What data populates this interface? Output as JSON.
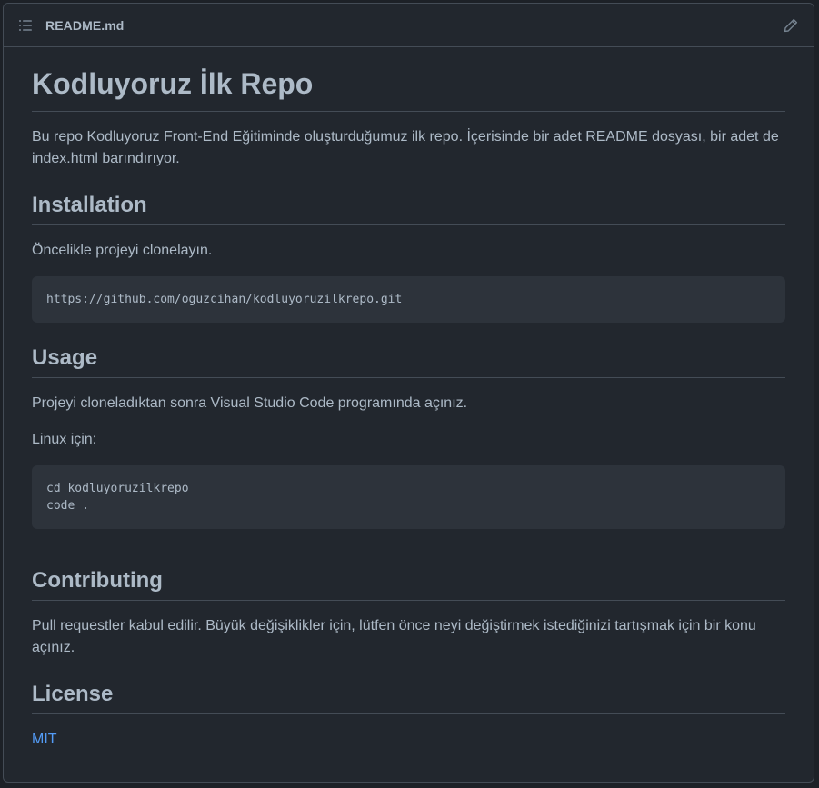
{
  "header": {
    "file_name": "README.md",
    "toc_icon": "list-unordered-icon",
    "edit_icon": "pencil-icon"
  },
  "readme": {
    "title": "Kodluyoruz İlk Repo",
    "intro": "Bu repo Kodluyoruz Front-End Eğitiminde oluşturduğumuz ilk repo. İçerisinde bir adet README dosyası, bir adet de index.html barındırıyor.",
    "installation": {
      "heading": "Installation",
      "text": "Öncelikle projeyi clonelayın.",
      "code": "https://github.com/oguzcihan/kodluyoruzilkrepo.git"
    },
    "usage": {
      "heading": "Usage",
      "text": "Projeyi cloneladıktan sonra Visual Studio Code programında açınız.",
      "linux_label": "Linux için:",
      "code": "cd kodluyoruzilkrepo\ncode ."
    },
    "contributing": {
      "heading": "Contributing",
      "text": "Pull requestler kabul edilir. Büyük değişiklikler için, lütfen önce neyi değiştirmek istediğinizi tartışmak için bir konu açınız."
    },
    "license": {
      "heading": "License",
      "link_text": "MIT"
    }
  },
  "colors": {
    "background": "#22272e",
    "border": "#444c56",
    "text": "#adbac7",
    "code_background": "#2d333b",
    "link": "#539bf5"
  }
}
